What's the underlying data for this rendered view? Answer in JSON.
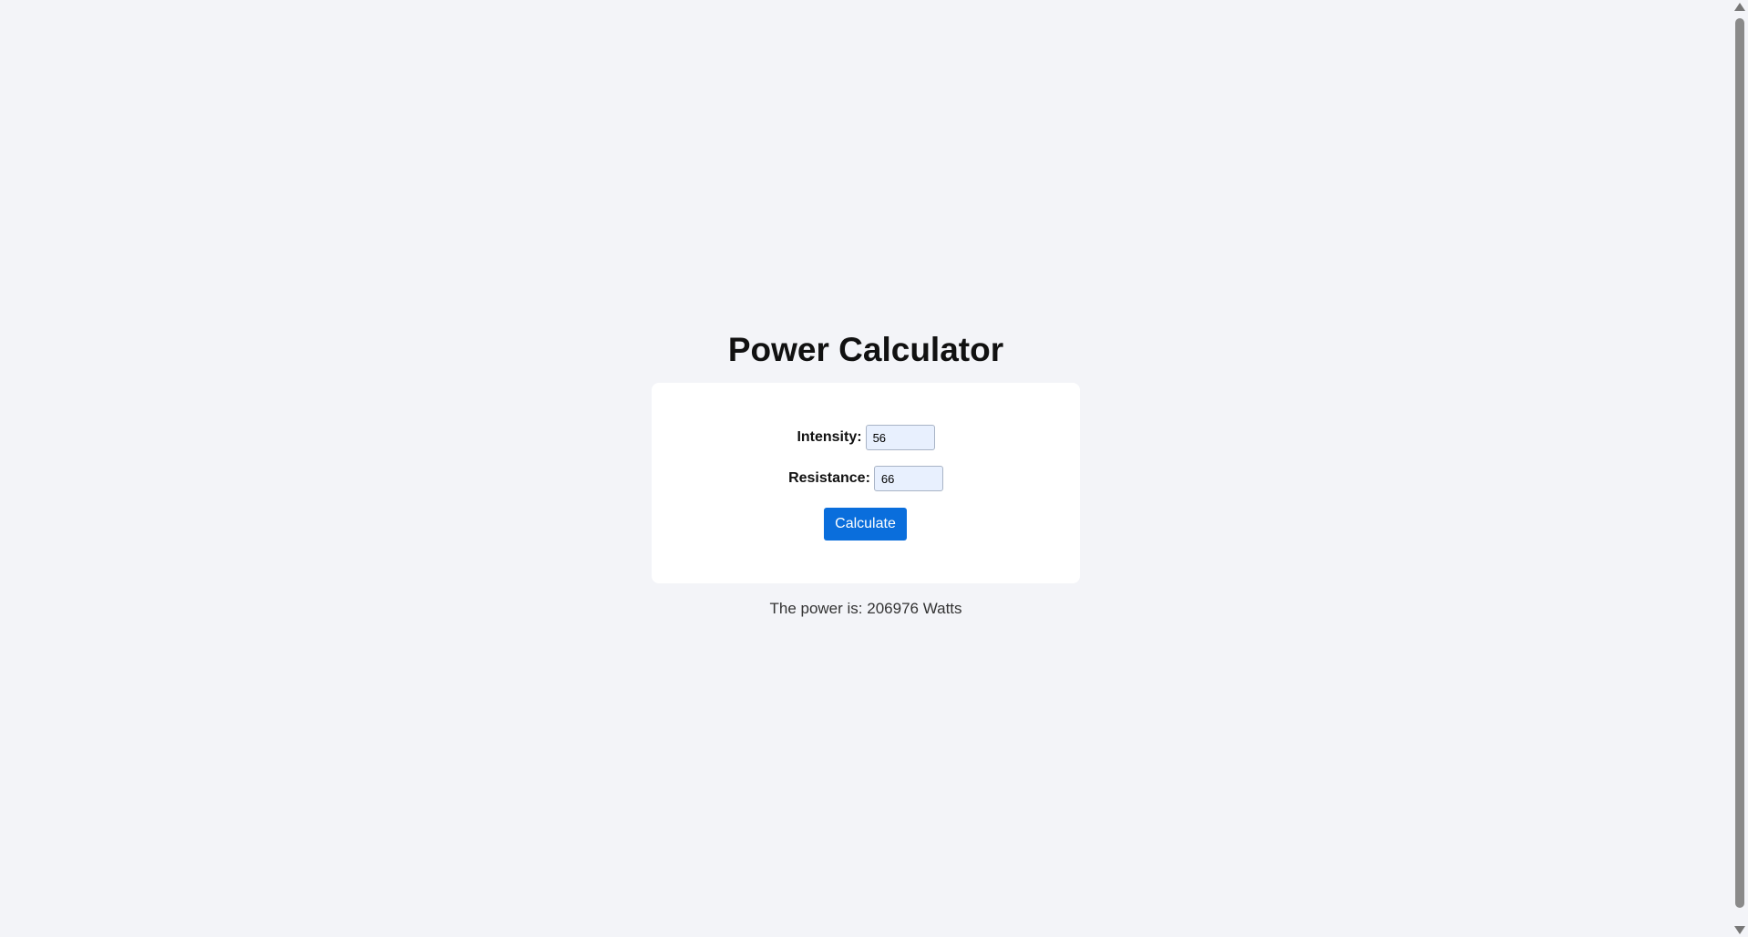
{
  "app": {
    "title": "Power Calculator"
  },
  "form": {
    "intensity_label": "Intensity:",
    "intensity_value": "56",
    "resistance_label": "Resistance:",
    "resistance_value": "66",
    "calculate_label": "Calculate"
  },
  "result": {
    "text": "The power is: 206976 Watts"
  },
  "colors": {
    "background": "#f3f4f8",
    "card": "#ffffff",
    "button": "#0a6edc",
    "input_bg": "#e8f0fe"
  }
}
